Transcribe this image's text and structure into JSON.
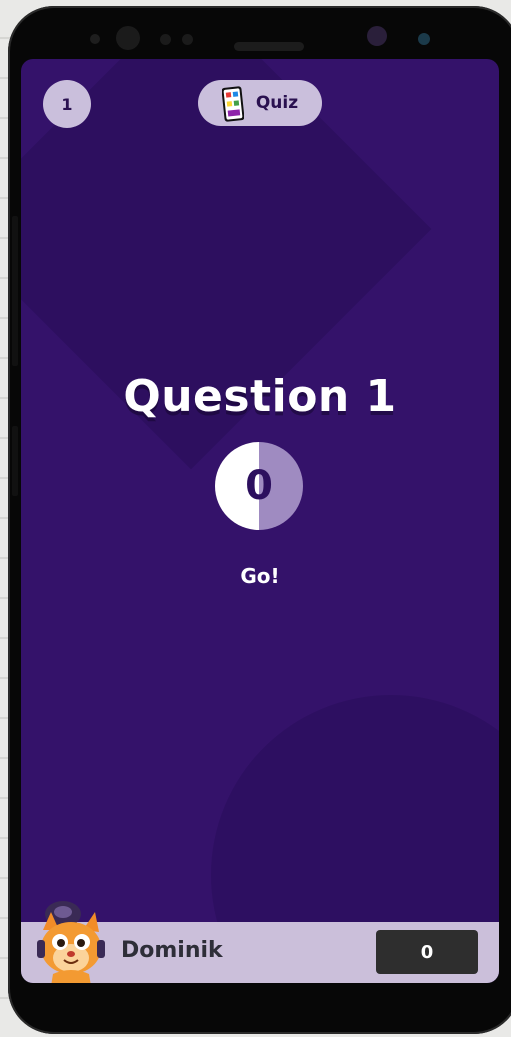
{
  "header": {
    "round_number": "1",
    "mode_label": "Quiz",
    "mode_icon": "quiz-cards-icon"
  },
  "main": {
    "title": "Question 1",
    "timer_value": "0",
    "status": "Go!"
  },
  "player": {
    "name": "Dominik",
    "score": "0",
    "avatar": "cat-avatar-icon"
  },
  "colors": {
    "background": "#34126a",
    "accent_light": "#cabfdc",
    "timer_fill": "#9f8bc1",
    "score_box": "#2e2e2e"
  }
}
